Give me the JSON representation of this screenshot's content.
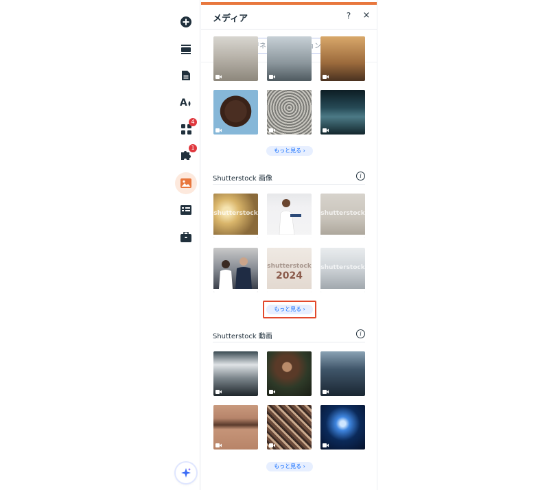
{
  "panel": {
    "title": "メディア",
    "help": "?",
    "close": "×",
    "search_placeholder": "例：ビジネス、ファッション、フィッ"
  },
  "rail": {
    "badges": {
      "apps": "4",
      "plugins": "1"
    }
  },
  "sections": {
    "more_label": "もっと見る",
    "shutterstock_images": {
      "title": "Shutterstock 画像",
      "info": "i"
    },
    "shutterstock_videos": {
      "title": "Shutterstock 動画",
      "info": "i"
    }
  },
  "watermarks": {
    "shutterstock": "shutterstock",
    "year": "2024"
  },
  "colors": {
    "accent": "#e8773d",
    "link": "#116dff",
    "highlight": "#e2492c"
  }
}
